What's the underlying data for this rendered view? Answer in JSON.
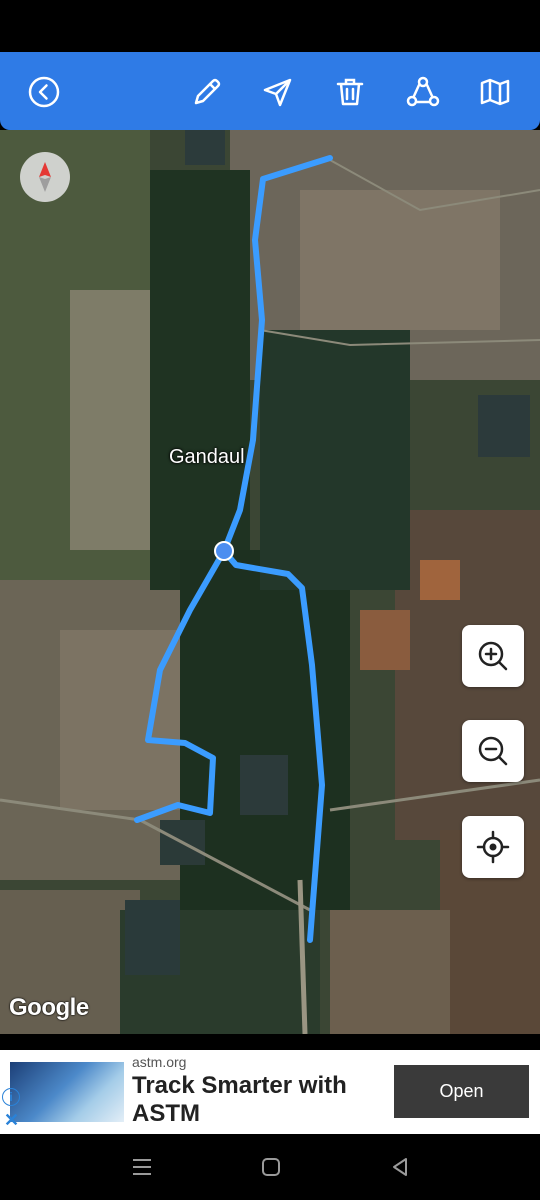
{
  "toolbar": {
    "icons": [
      "back-icon",
      "pencil-icon",
      "send-icon",
      "trash-icon",
      "share-icon",
      "map-icon"
    ]
  },
  "map": {
    "place_label": "Gandaul",
    "attribution": "Google",
    "controls": [
      "zoom-in-icon",
      "zoom-out-icon",
      "my-location-icon"
    ],
    "route_color": "#3b9cff"
  },
  "ad": {
    "domain": "astm.org",
    "title": "Track Smarter with ASTM",
    "button_label": "Open"
  },
  "colors": {
    "toolbar": "#2f7be6",
    "route": "#3b9cff"
  }
}
